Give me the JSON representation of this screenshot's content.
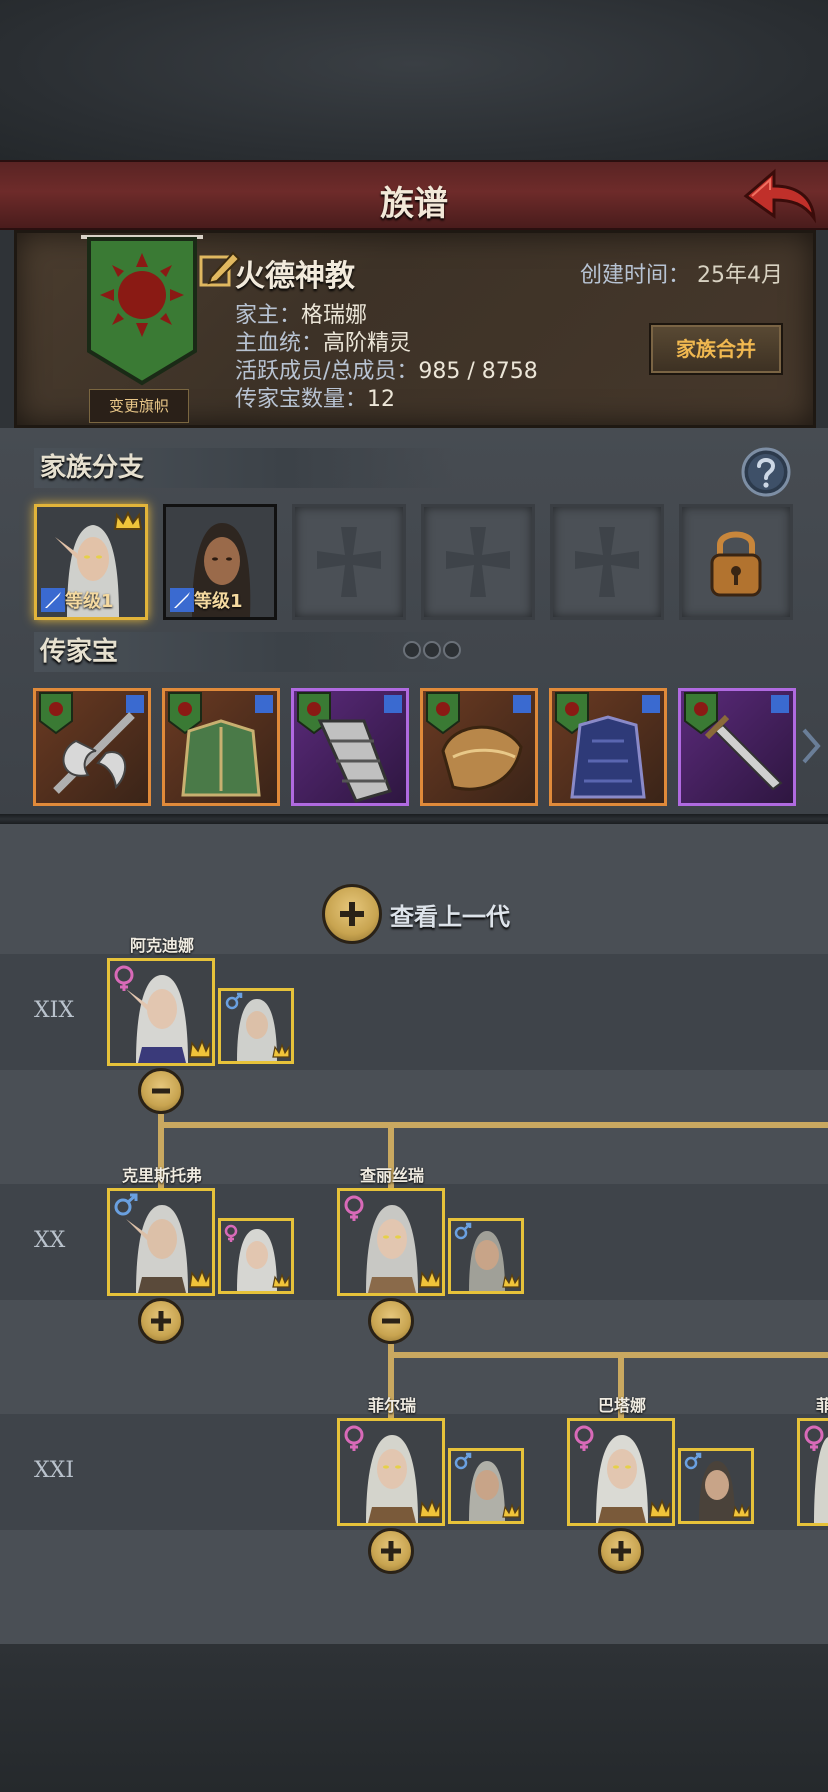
{
  "header": {
    "title": "族谱"
  },
  "clan": {
    "name": "火德神教",
    "create_time_label": "创建时间：",
    "create_time_value": "25年4月",
    "leader_label": "家主：",
    "leader_value": "格瑞娜",
    "bloodline_label": "主血统：",
    "bloodline_value": "高阶精灵",
    "members_label": "活跃成员/总成员：",
    "members_value": "985 / 8758",
    "heirloom_count_label": "传家宝数量：",
    "heirloom_count_value": "12",
    "change_flag_button": "变更旗帜",
    "merge_button": "家族合并"
  },
  "branches": {
    "title": "家族分支",
    "slots": [
      {
        "state": "filled",
        "level": "等级1",
        "crown": true
      },
      {
        "state": "filled",
        "level": "等级1",
        "crown": false
      },
      {
        "state": "empty"
      },
      {
        "state": "empty"
      },
      {
        "state": "empty"
      },
      {
        "state": "locked"
      }
    ]
  },
  "heirlooms": {
    "title": "传家宝",
    "items": [
      {
        "name": "halberd",
        "rarity": "orange"
      },
      {
        "name": "green-armor",
        "rarity": "orange"
      },
      {
        "name": "gauntlet",
        "rarity": "purple"
      },
      {
        "name": "golden-helm",
        "rarity": "orange"
      },
      {
        "name": "blue-armor",
        "rarity": "orange"
      },
      {
        "name": "sword",
        "rarity": "purple"
      }
    ]
  },
  "tree": {
    "view_previous_label": "查看上一代",
    "generations": [
      {
        "label": "XIX",
        "members": [
          {
            "name": "阿克迪娜",
            "gender": "female",
            "spouse_gender": "male",
            "expanded": true
          }
        ]
      },
      {
        "label": "XX",
        "members": [
          {
            "name": "克里斯托弗",
            "gender": "male",
            "spouse_gender": "female",
            "expanded": false
          },
          {
            "name": "查丽丝瑞",
            "gender": "female",
            "spouse_gender": "male",
            "expanded": true
          }
        ]
      },
      {
        "label": "XXI",
        "members": [
          {
            "name": "菲尔瑞",
            "gender": "female",
            "spouse_gender": "male",
            "expanded": false
          },
          {
            "name": "巴塔娜",
            "gender": "female",
            "spouse_gender": "male",
            "expanded": false
          },
          {
            "name": "菲",
            "gender": "female",
            "spouse_gender": "",
            "expanded": false
          }
        ]
      }
    ]
  },
  "colors": {
    "accent_gold": "#e6c23a",
    "title_bar": "#6e2b2a",
    "orange_rarity": "#e08a3a",
    "purple_rarity": "#b06ae0",
    "female_icon": "#d86ab8",
    "male_icon": "#6aa0e0"
  }
}
